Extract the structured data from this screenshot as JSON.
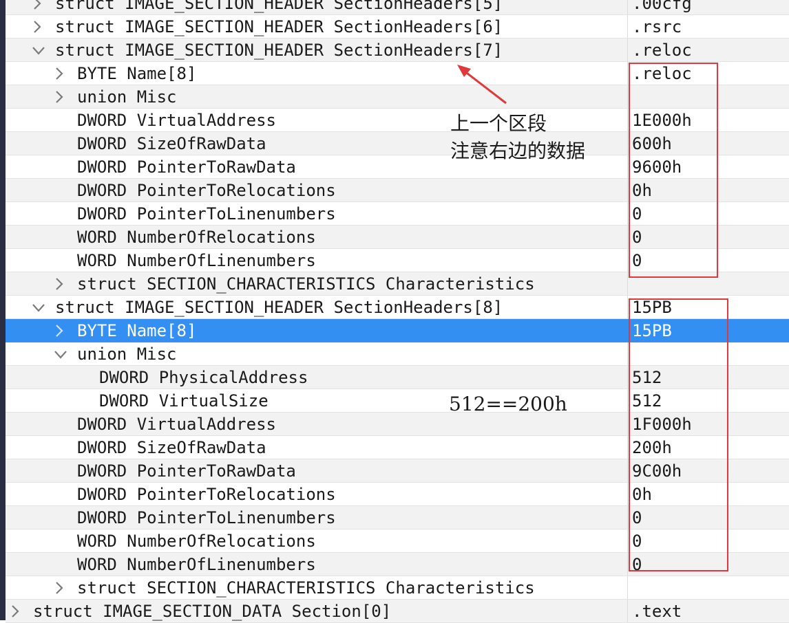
{
  "rows": [
    {
      "indent": 0,
      "chevron": "right",
      "name": "struct IMAGE_SECTION_HEADER SectionHeaders[5]",
      "value": ".00cfg",
      "alt": true
    },
    {
      "indent": 0,
      "chevron": "right",
      "name": "struct IMAGE_SECTION_HEADER SectionHeaders[6]",
      "value": ".rsrc",
      "alt": false
    },
    {
      "indent": 0,
      "chevron": "down",
      "name": "struct IMAGE_SECTION_HEADER SectionHeaders[7]",
      "value": ".reloc",
      "alt": true
    },
    {
      "indent": 1,
      "chevron": "right",
      "name": "BYTE Name[8]",
      "value": ".reloc",
      "alt": false
    },
    {
      "indent": 1,
      "chevron": "right",
      "name": "union Misc",
      "value": "",
      "alt": true
    },
    {
      "indent": 1,
      "chevron": "none",
      "name": "DWORD VirtualAddress",
      "value": "1E000h",
      "alt": false
    },
    {
      "indent": 1,
      "chevron": "none",
      "name": "DWORD SizeOfRawData",
      "value": "600h",
      "alt": true
    },
    {
      "indent": 1,
      "chevron": "none",
      "name": "DWORD PointerToRawData",
      "value": "9600h",
      "alt": false
    },
    {
      "indent": 1,
      "chevron": "none",
      "name": "DWORD PointerToRelocations",
      "value": "0h",
      "alt": true
    },
    {
      "indent": 1,
      "chevron": "none",
      "name": "DWORD PointerToLinenumbers",
      "value": "0",
      "alt": false
    },
    {
      "indent": 1,
      "chevron": "none",
      "name": "WORD NumberOfRelocations",
      "value": "0",
      "alt": true
    },
    {
      "indent": 1,
      "chevron": "none",
      "name": "WORD NumberOfLinenumbers",
      "value": "0",
      "alt": false
    },
    {
      "indent": 1,
      "chevron": "right",
      "name": "struct SECTION_CHARACTERISTICS Characteristics",
      "value": "",
      "alt": true
    },
    {
      "indent": 0,
      "chevron": "down",
      "name": "struct IMAGE_SECTION_HEADER SectionHeaders[8]",
      "value": "15PB",
      "alt": false
    },
    {
      "indent": 1,
      "chevron": "right",
      "name": "BYTE Name[8]",
      "value": "15PB",
      "alt": false,
      "selected": true
    },
    {
      "indent": 1,
      "chevron": "down",
      "name": "union Misc",
      "value": "",
      "alt": false
    },
    {
      "indent": 2,
      "chevron": "none",
      "name": "DWORD PhysicalAddress",
      "value": "512",
      "alt": true
    },
    {
      "indent": 2,
      "chevron": "none",
      "name": "DWORD VirtualSize",
      "value": "512",
      "alt": false
    },
    {
      "indent": 1,
      "chevron": "none",
      "name": "DWORD VirtualAddress",
      "value": "1F000h",
      "alt": true
    },
    {
      "indent": 1,
      "chevron": "none",
      "name": "DWORD SizeOfRawData",
      "value": "200h",
      "alt": false
    },
    {
      "indent": 1,
      "chevron": "none",
      "name": "DWORD PointerToRawData",
      "value": "9C00h",
      "alt": true
    },
    {
      "indent": 1,
      "chevron": "none",
      "name": "DWORD PointerToRelocations",
      "value": "0h",
      "alt": false
    },
    {
      "indent": 1,
      "chevron": "none",
      "name": "DWORD PointerToLinenumbers",
      "value": "0",
      "alt": true
    },
    {
      "indent": 1,
      "chevron": "none",
      "name": "WORD NumberOfRelocations",
      "value": "0",
      "alt": false
    },
    {
      "indent": 1,
      "chevron": "none",
      "name": "WORD NumberOfLinenumbers",
      "value": "0",
      "alt": true
    },
    {
      "indent": 1,
      "chevron": "right",
      "name": "struct SECTION_CHARACTERISTICS Characteristics",
      "value": "",
      "alt": false
    },
    {
      "indent": -1,
      "chevron": "right",
      "name": "struct IMAGE_SECTION_DATA Section[0]",
      "value": ".text",
      "alt": true
    }
  ],
  "annotations": {
    "prev_section_line1": "上一个区段",
    "prev_section_line2": "注意右边的数据",
    "size_note": "512==200h"
  },
  "colors": {
    "highlight": "#e0393b",
    "selection": "#3390f2"
  }
}
